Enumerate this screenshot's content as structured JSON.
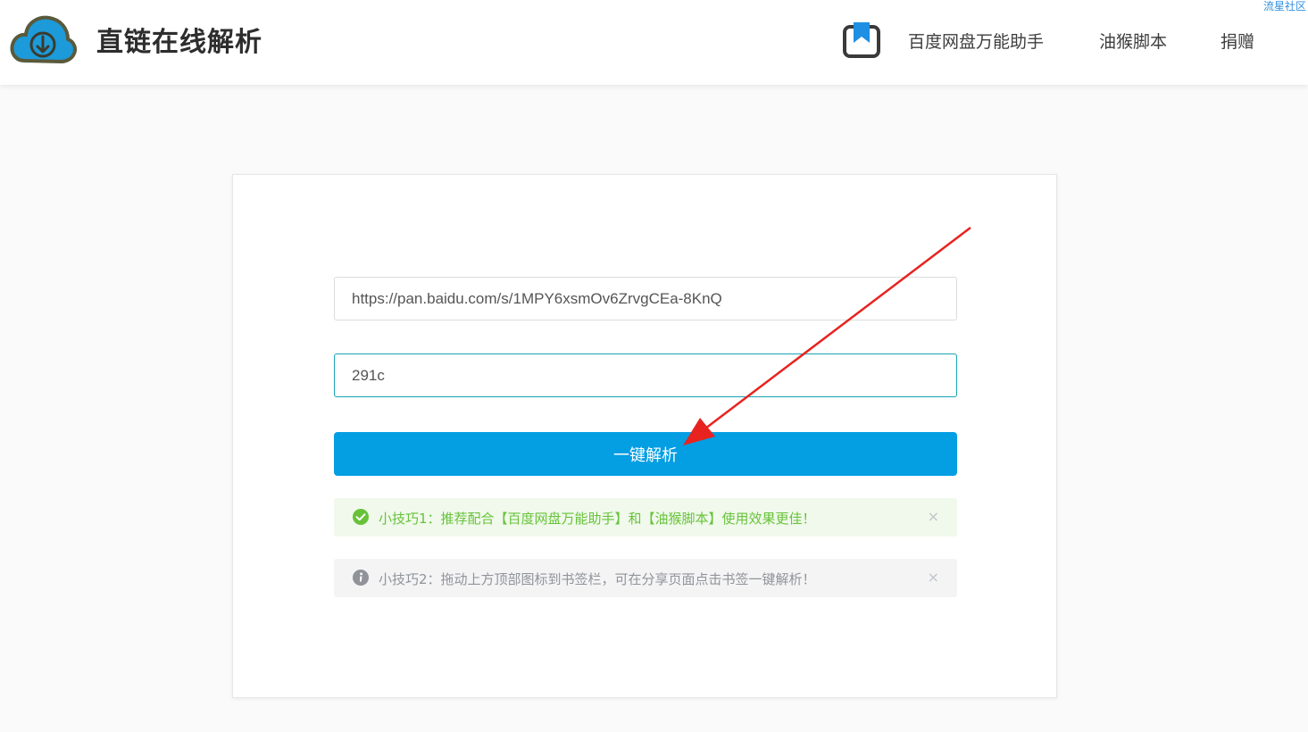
{
  "header": {
    "watermark": "流星社区",
    "title": "直链在线解析",
    "nav": [
      {
        "label": "百度网盘万能助手"
      },
      {
        "label": "油猴脚本"
      },
      {
        "label": "捐赠"
      }
    ]
  },
  "form": {
    "link_value": "https://pan.baidu.com/s/1MPY6xsmOv6ZrvgCEa-8KnQ",
    "code_value": "291c",
    "button_label": "一键解析"
  },
  "alerts": [
    {
      "type": "success",
      "text": "小技巧1：推荐配合【百度网盘万能助手】和【油猴脚本】使用效果更佳！",
      "close": "×"
    },
    {
      "type": "info",
      "text": "小技巧2：拖动上方顶部图标到书签栏，可在分享页面点击书签一键解析！",
      "close": "×"
    }
  ],
  "colors": {
    "brand": "#049ee3",
    "success": "#67c23a",
    "info": "#909399",
    "annotation_arrow": "#e8231f"
  },
  "icons": {
    "logo": "cloud-download-icon",
    "bookmark": "bookmark-icon",
    "success": "check-circle-icon",
    "info": "info-circle-icon",
    "close": "close-icon"
  }
}
